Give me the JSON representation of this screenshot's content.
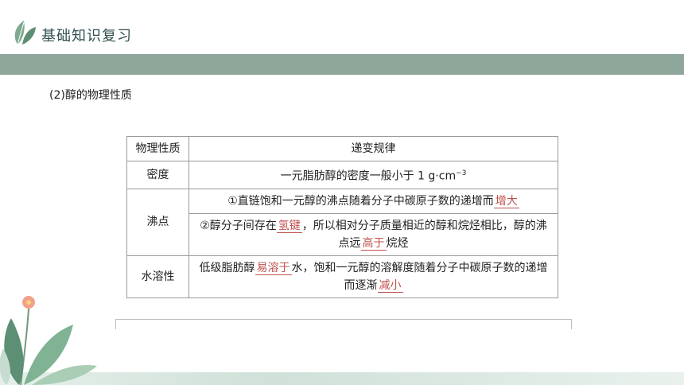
{
  "header": {
    "title": "基础知识复习"
  },
  "subtitle": "(2)醇的物理性质",
  "table": {
    "headers": [
      "物理性质",
      "递变规律"
    ],
    "density": {
      "label": "密度",
      "text": "一元脂肪醇的密度一般小于 1 g·cm",
      "unit_exp": "−3"
    },
    "boiling": {
      "label": "沸点",
      "r1_a": "①直链饱和一元醇的沸点随着分子中碳原子数的递增而",
      "r1_fill": "增大",
      "r2_a": "②醇分子间存在",
      "r2_fill1": "氢键",
      "r2_b": "，所以相对分子质量相近的醇和烷烃相比，醇的沸点远",
      "r2_fill2": "高于",
      "r2_c": "烷烃"
    },
    "solubility": {
      "label": "水溶性",
      "a": "低级脂肪醇",
      "fill1": "易溶于",
      "b": "水，饱和一元醇的溶解度随着分子中碳原子数的递增而逐渐",
      "fill2": "减小"
    }
  },
  "colors": {
    "band": "#8fa79b",
    "fill_text": "#c0504d"
  }
}
